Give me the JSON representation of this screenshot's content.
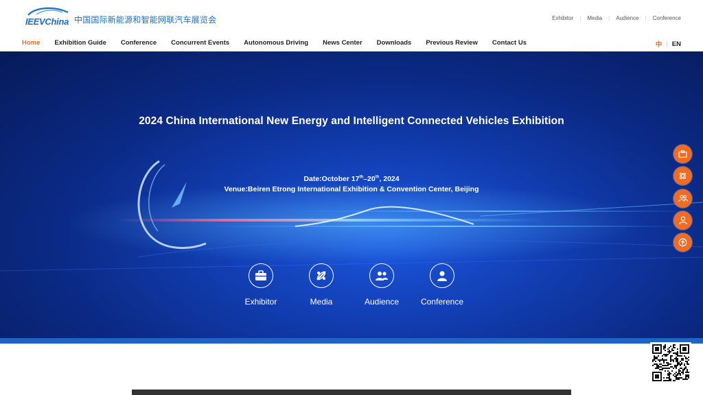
{
  "brand": {
    "logo_text": "IEEVChina",
    "name_cn": "中国国际新能源和智能网联汽车展览会"
  },
  "top_links": [
    "Exhibitor",
    "Media",
    "Audience",
    "Conference"
  ],
  "nav": {
    "items": [
      "Home",
      "Exhibition Guide",
      "Conference",
      "Concurrent Events",
      "Autonomous Driving",
      "News Center",
      "Downloads",
      "Previous Review",
      "Contact Us"
    ],
    "active": "Home"
  },
  "lang": {
    "cn": "中",
    "en": "EN"
  },
  "hero": {
    "title": "2024 China International New Energy and Intelligent Connected Vehicles Exhibition",
    "date_prefix": "Date:October 17",
    "date_sup1": "th",
    "date_mid": "–20",
    "date_sup2": "th",
    "date_suffix": ", 2024",
    "venue": "Venue:Beiren Etrong International Exhibition & Convention Center, Beijing"
  },
  "entry_icons": [
    {
      "label": "Exhibitor",
      "icon": "briefcase-icon"
    },
    {
      "label": "Media",
      "icon": "media-icon"
    },
    {
      "label": "Audience",
      "icon": "audience-icon"
    },
    {
      "label": "Conference",
      "icon": "person-icon"
    }
  ],
  "side_buttons": [
    "briefcase-icon",
    "media-icon",
    "audience-icon",
    "person-icon",
    "back-to-top-icon"
  ],
  "colors": {
    "accent": "#f26b22",
    "brand_blue": "#1a6fc6",
    "hero_blue": "#123fb4"
  }
}
